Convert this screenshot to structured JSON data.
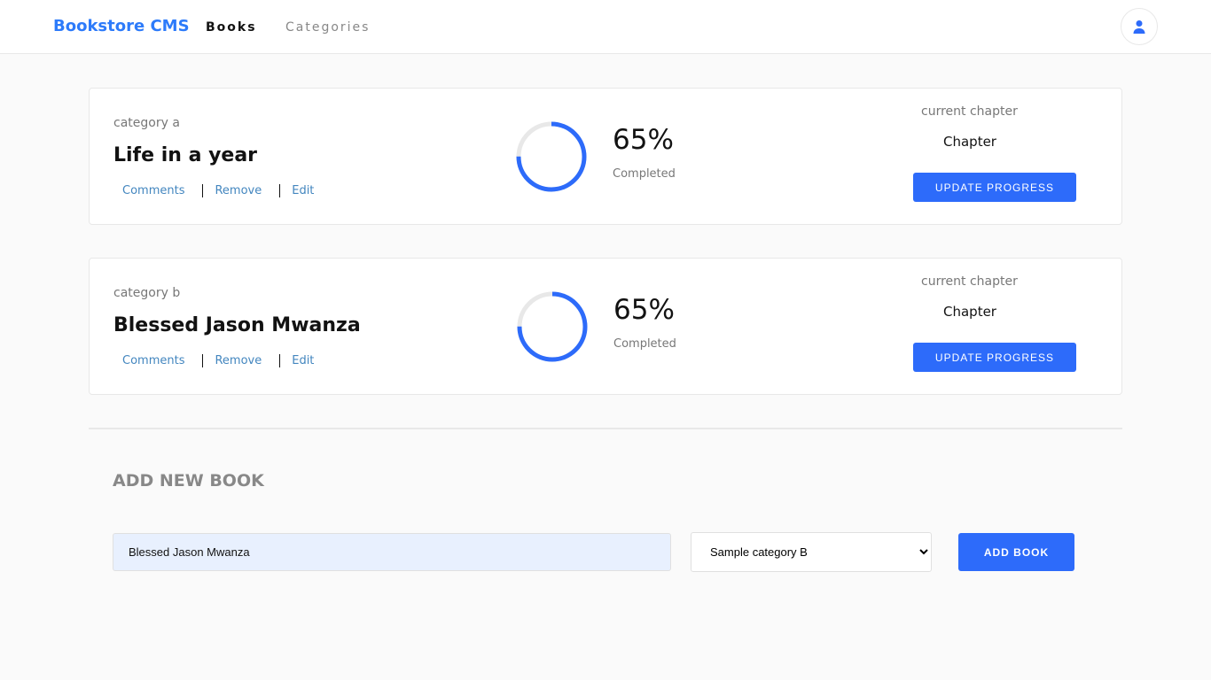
{
  "header": {
    "brand": "Bookstore CMS",
    "nav": [
      {
        "label": "Books",
        "active": true
      },
      {
        "label": "Categories",
        "active": false
      }
    ],
    "user_icon": "user-icon"
  },
  "books": [
    {
      "category": "category a",
      "title": "Life in a year",
      "actions": [
        "Comments",
        "Remove",
        "Edit"
      ],
      "percent": "65%",
      "ring_fill_percent": 75,
      "completed_label": "Completed",
      "current_chapter_label": "current chapter",
      "chapter": "Chapter",
      "update_label": "UPDATE PROGRESS"
    },
    {
      "category": "category b",
      "title": "Blessed Jason Mwanza",
      "actions": [
        "Comments",
        "Remove",
        "Edit"
      ],
      "percent": "65%",
      "ring_fill_percent": 75,
      "completed_label": "Completed",
      "current_chapter_label": "current chapter",
      "chapter": "Chapter",
      "update_label": "UPDATE PROGRESS"
    }
  ],
  "add_book": {
    "title": "ADD NEW BOOK",
    "input_value": "Blessed Jason Mwanza",
    "category_selected": "Sample category B",
    "button_label": "ADD BOOK"
  },
  "colors": {
    "accent": "#2d6bfa",
    "brand": "#2d7bfa",
    "ring_track": "#e8e8e8"
  }
}
